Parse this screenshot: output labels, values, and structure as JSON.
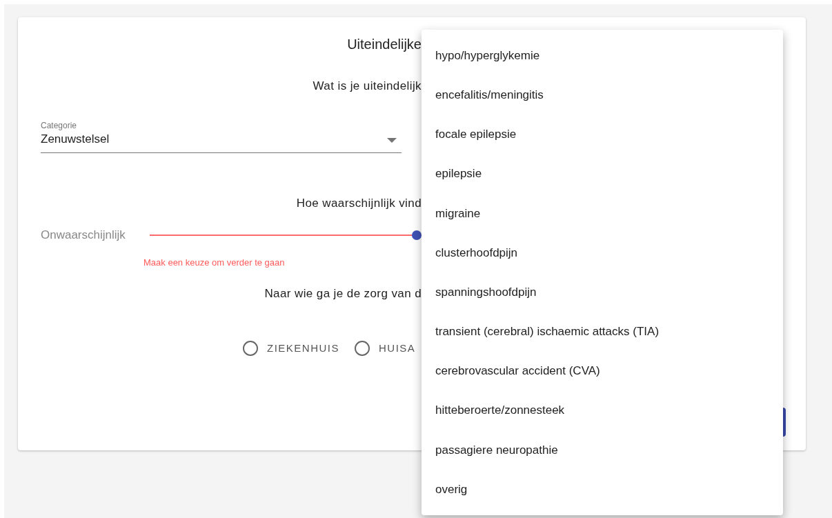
{
  "card": {
    "title": "Uiteindelijke",
    "question_diagnosis": "Wat is je uiteindelijk",
    "category_field": {
      "label": "Categorie",
      "value": "Zenuwstelsel",
      "expanded": true
    },
    "question_likelihood": "Hoe waarschijnlijk vind",
    "likelihood_slider": {
      "min_label": "Onwaarschijnlijk",
      "level": 0.5,
      "error": true,
      "error_message": "Maak een keuze om verder te gaan"
    },
    "question_handover": "Naar wie ga je de zorg van d",
    "handover_options": [
      {
        "label": "ZIEKENHUIS",
        "selected": false
      },
      {
        "label": "HUISA",
        "selected": false
      }
    ]
  },
  "category_menu": [
    "hypo/hyperglykemie",
    "encefalitis/meningitis",
    "focale epilepsie",
    "epilepsie",
    "migraine",
    "clusterhoofdpijn",
    "spanningshoofdpijn",
    "transient (cerebral) ischaemic attacks (TIA)",
    "cerebrovascular accident (CVA)",
    "hitteberoerte/zonnesteek",
    "passagiere neuropathie",
    "overig"
  ]
}
